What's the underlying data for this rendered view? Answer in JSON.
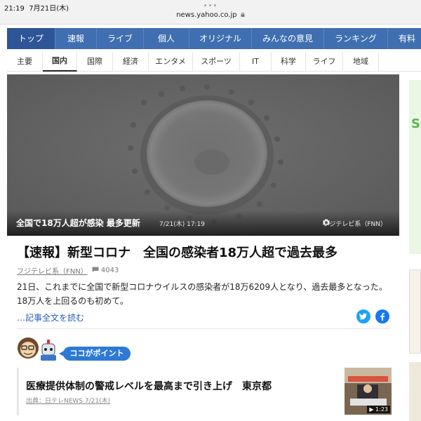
{
  "status": {
    "time": "21:19",
    "date": "7月21日(木)",
    "dots": "•••",
    "url": "news.yahoo.co.jp"
  },
  "nav_main": [
    "トップ",
    "速報",
    "ライブ",
    "個人",
    "オリジナル",
    "みんなの意見",
    "ランキング",
    "有料"
  ],
  "nav_main_active": 0,
  "nav_sub": [
    "主要",
    "国内",
    "国際",
    "経済",
    "エンタメ",
    "スポーツ",
    "IT",
    "科学",
    "ライフ",
    "地域"
  ],
  "nav_sub_active": 1,
  "hero": {
    "caption": "全国で18万人超が感染 最多更新",
    "time": "7/21(木) 17:19",
    "credit": "フジテレビ系（FNN）"
  },
  "article": {
    "headline": "【速報】新型コロナ　全国の感染者18万人超で過去最多",
    "source": "フジテレビ系（FNN）",
    "comments": "4043",
    "summary": "21日、これまでに全国で新型コロナウイルスの感染者が18万6209人となり、過去最多となった。18万人を上回るのも初めて。",
    "read_more": "…記事全文を読む"
  },
  "share": {
    "twitter_icon": "twitter-icon",
    "facebook_icon": "facebook-icon"
  },
  "point": {
    "label": "ココがポイント"
  },
  "related": {
    "title": "医療提供体制の警戒レベルを最高まで引き上げ　東京都",
    "meta": "出典：日テレNEWS 7/21(木)",
    "duration": "1:23"
  },
  "colors": {
    "nav_blue": "#3f6fb1",
    "link_blue": "#2a5cb8",
    "point_blue": "#2d7ad6"
  }
}
